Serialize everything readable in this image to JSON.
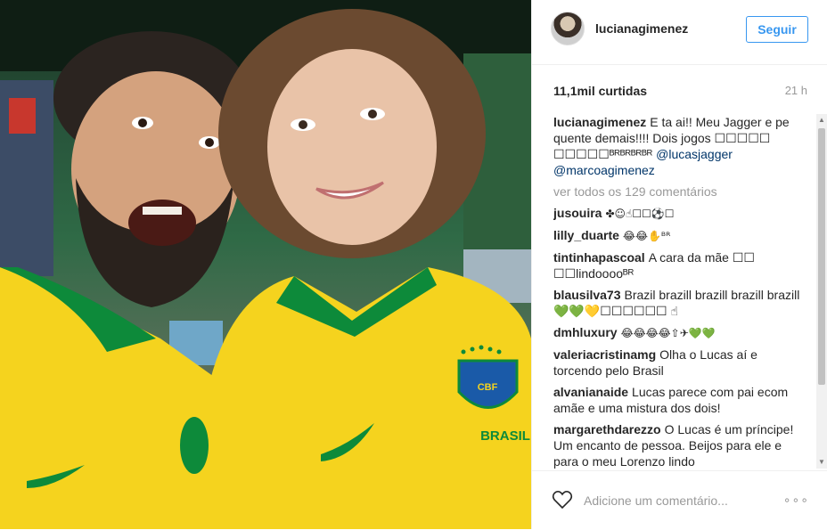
{
  "header": {
    "username": "lucianagimenez",
    "follow_label": "Seguir"
  },
  "stats": {
    "likes": "11,1mil curtidas",
    "time": "21 h"
  },
  "caption": {
    "username": "lucianagimenez",
    "text": "E ta ai!! Meu Jagger e pe quente demais!!!! Dois jogos ☐☐☐☐☐ ☐☐☐☐☐ᴮᴿᴮᴿᴮᴿᴮᴿ",
    "mention1": "@lucasjagger",
    "mention2": "@marcoagimenez"
  },
  "view_all": "ver todos os 129 comentários",
  "comments": [
    {
      "user": "jusouira",
      "text": "✤☺☝☐☐⚽☐"
    },
    {
      "user": "lilly_duarte",
      "text": "😂😂✋ᴮᴿ"
    },
    {
      "user": "tintinhapascoal",
      "text": "A cara da mãe ☐☐ ☐☐lindooooᴮᴿ"
    },
    {
      "user": "blausilva73",
      "text": "Brazil brazill brazill brazill brazill 💚💚💛☐☐☐☐☐☐ ☝"
    },
    {
      "user": "dmhluxury",
      "text": "😂😂😂😂⇧✈💚💚"
    },
    {
      "user": "valeriacristinamg",
      "text": "Olha o Lucas aí e torcendo pelo Brasil"
    },
    {
      "user": "alvanianaide",
      "text": "Lucas parece com pai ecom amãe e uma mistura dos dois!"
    },
    {
      "user": "margarethdarezzo",
      "text": "O Lucas é um príncipe! Um encanto de pessoa. Beijos para ele e para o meu Lorenzo lindo"
    }
  ],
  "footer": {
    "comment_placeholder": "Adicione um comentário...",
    "more": "∘∘∘"
  },
  "photo": {
    "shirt_text": "BRASIL",
    "crest_text": "CBF"
  },
  "colors": {
    "link": "#003569",
    "follow": "#3897f0",
    "muted": "#999999",
    "jersey_yellow": "#f5d31e",
    "jersey_green": "#0d8a3a"
  }
}
